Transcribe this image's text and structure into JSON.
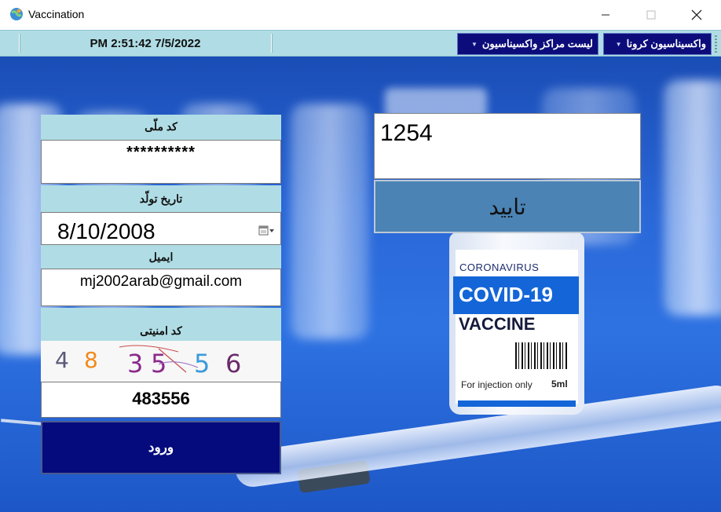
{
  "window": {
    "title": "Vaccination",
    "icon": "globe-app-icon",
    "controls": {
      "minimize": "—",
      "maximize": "☐",
      "close": "✕"
    }
  },
  "strip": {
    "datetime": "PM 2:51:42 7/5/2022",
    "menu_corona": "واکسیناسیون کرونا",
    "menu_centers": "لیست مراکز واکسیناسیون",
    "caret": "▼"
  },
  "form": {
    "national_code_label": "کد ملّی",
    "national_code_value": "**********",
    "birth_date_label": "تاریخ تولّد",
    "birth_date_value": "8/10/2008",
    "email_label": "ایمیل",
    "email_value": "mj2002arab@gmail.com",
    "security_code_label": "کد امنیتی",
    "captcha_text": [
      "4",
      "8",
      "3",
      "5",
      "5",
      "6"
    ],
    "captcha_colors": [
      "#5a5a7a",
      "#f28a1a",
      "#8a2a8a",
      "#8a2a8a",
      "#3a9ad9",
      "#6a2a6a"
    ],
    "captcha_input": "483556",
    "login_label": "ورود"
  },
  "verify": {
    "code_value": "1254",
    "confirm_label": "تایید"
  },
  "vial": {
    "brand_line": "CORONAVIRUS",
    "name": "COVID-19",
    "product": "VACCINE",
    "usage": "For injection only",
    "volume": "5ml"
  },
  "colors": {
    "strip": "#b0dde5",
    "menu_bg": "#0c0d7a",
    "login_bg": "#050b7d",
    "confirm_bg": "#4b83b5"
  }
}
